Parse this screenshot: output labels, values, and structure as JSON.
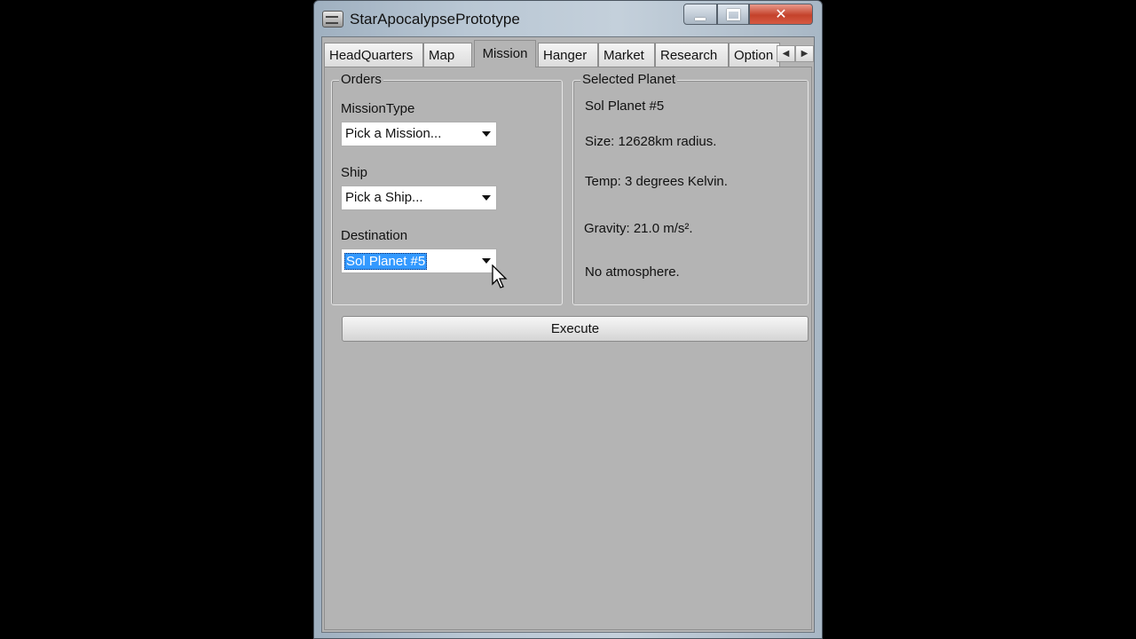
{
  "window": {
    "title": "StarApocalypsePrototype"
  },
  "controls": {
    "minimize": "minimize",
    "maximize": "maximize",
    "close": "✕"
  },
  "tabs": [
    {
      "label": "HeadQuarters",
      "active": false
    },
    {
      "label": "Map",
      "active": false
    },
    {
      "label": "Mission",
      "active": true
    },
    {
      "label": "Hanger",
      "active": false
    },
    {
      "label": "Market",
      "active": false
    },
    {
      "label": "Research",
      "active": false
    },
    {
      "label": "Option",
      "active": false
    }
  ],
  "tab_scroll": {
    "left": "◀",
    "right": "▶"
  },
  "orders": {
    "legend": "Orders",
    "mission_type_label": "MissionType",
    "mission_type_value": "Pick a Mission...",
    "ship_label": "Ship",
    "ship_value": "Pick a Ship...",
    "destination_label": "Destination",
    "destination_value": "Sol Planet #5"
  },
  "selected_planet": {
    "legend": "Selected Planet",
    "name": "Sol Planet #5",
    "size": "Size: 12628km radius.",
    "temp": "Temp: 3 degrees Kelvin.",
    "gravity": "Gravity: 21.0 m/s².",
    "atmosphere": "No atmosphere."
  },
  "execute_label": "Execute",
  "colors": {
    "client_bg": "#b4b4b4",
    "selection": "#3399ff",
    "close_button": "#c4422b"
  }
}
